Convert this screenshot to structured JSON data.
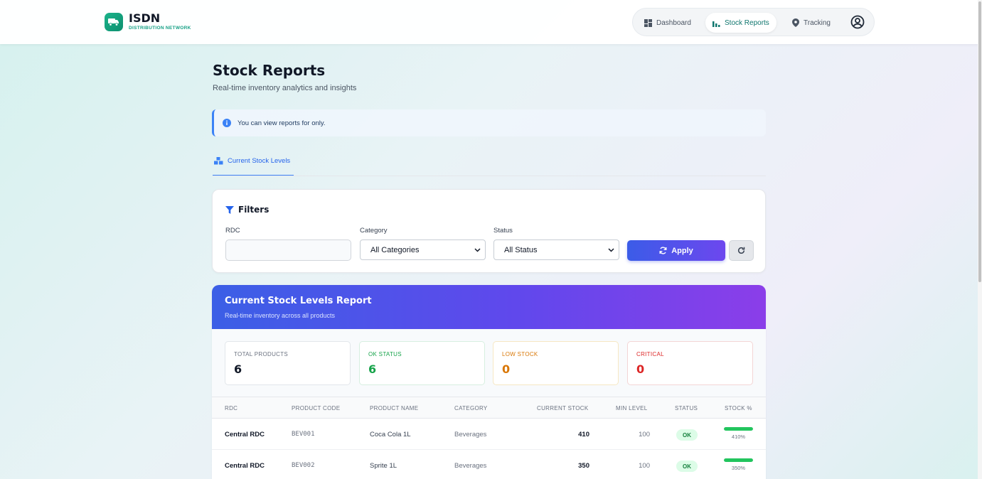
{
  "brand": {
    "title": "ISDN",
    "subtitle": "DISTRIBUTION NETWORK"
  },
  "nav": {
    "items": [
      {
        "label": "Dashboard",
        "icon": "dashboard-icon"
      },
      {
        "label": "Stock Reports",
        "icon": "bar-chart-icon",
        "active": true
      },
      {
        "label": "Tracking",
        "icon": "map-pin-icon"
      }
    ],
    "user_icon": "user-circle-icon"
  },
  "page": {
    "title": "Stock Reports",
    "subtitle": "Real-time inventory analytics and insights"
  },
  "alert": {
    "icon": "info-icon",
    "text": "You can view reports for only."
  },
  "tabs": [
    {
      "label": "Current Stock Levels",
      "icon": "boxes-icon",
      "active": true
    }
  ],
  "filters": {
    "heading": "Filters",
    "rdc_label": "RDC",
    "rdc_value": "",
    "category_label": "Category",
    "category_value": "All Categories",
    "status_label": "Status",
    "status_value": "All Status",
    "apply_label": "Apply"
  },
  "report": {
    "title": "Current Stock Levels Report",
    "subtitle": "Real-time inventory across all products",
    "stats": [
      {
        "label": "TOTAL PRODUCTS",
        "value": "6",
        "color": "#111827",
        "label_color": "#6b7280",
        "border": "#e2e6ea"
      },
      {
        "label": "OK STATUS",
        "value": "6",
        "color": "#16a34a",
        "label_color": "#16a34a",
        "border": "#d7efe0"
      },
      {
        "label": "LOW STOCK",
        "value": "0",
        "color": "#d97706",
        "label_color": "#d97706",
        "border": "#f6e7c3"
      },
      {
        "label": "CRITICAL",
        "value": "0",
        "color": "#dc2626",
        "label_color": "#dc2626",
        "border": "#f3d5d5"
      }
    ],
    "columns": [
      "RDC",
      "PRODUCT CODE",
      "PRODUCT NAME",
      "CATEGORY",
      "CURRENT STOCK",
      "MIN LEVEL",
      "STATUS",
      "STOCK %"
    ],
    "rows": [
      {
        "rdc": "Central RDC",
        "code": "BEV001",
        "name": "Coca Cola 1L",
        "category": "Beverages",
        "stock": "410",
        "min": "100",
        "status": "OK",
        "pct": "410%",
        "fill": 1.0
      },
      {
        "rdc": "Central RDC",
        "code": "BEV002",
        "name": "Sprite 1L",
        "category": "Beverages",
        "stock": "350",
        "min": "100",
        "status": "OK",
        "pct": "350%",
        "fill": 1.0
      }
    ]
  }
}
